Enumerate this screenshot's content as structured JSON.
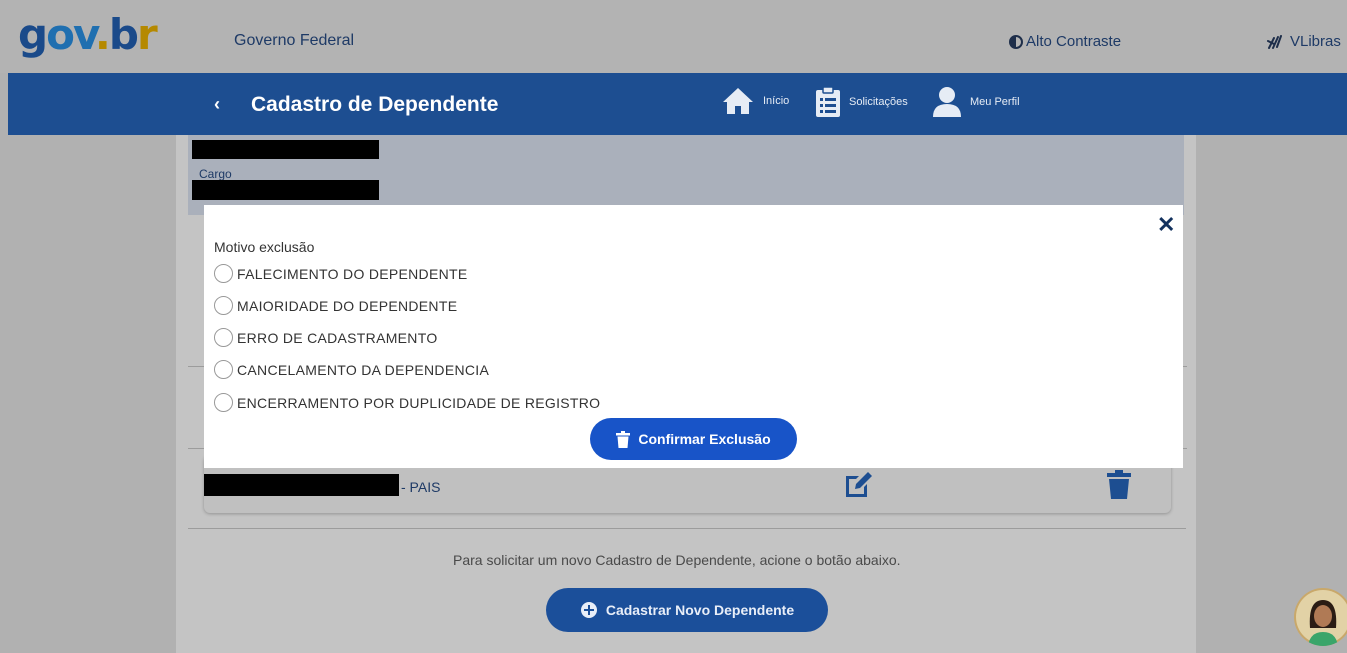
{
  "topbar": {
    "logo": {
      "g": "g",
      "o": "o",
      "v": "v",
      "dot": ".",
      "b": "b",
      "r": "r"
    },
    "gov_federal": "Governo Federal",
    "alto_contraste": "Alto Contraste",
    "vlibras": "VLibras"
  },
  "header": {
    "title": "Cadastro de Dependente",
    "nav": [
      {
        "label": "Início",
        "icon": "home-icon"
      },
      {
        "label": "Solicitações",
        "icon": "clipboard-icon"
      },
      {
        "label": "Meu Perfil",
        "icon": "user-icon"
      }
    ]
  },
  "info_card": {
    "cargo_label": "Cargo"
  },
  "dependent": {
    "relation": "- PAIS"
  },
  "footer": {
    "info": "Para solicitar um novo Cadastro de Dependente, acione o botão abaixo.",
    "new_button": "Cadastrar Novo Dependente"
  },
  "modal": {
    "label": "Motivo exclusão",
    "options": [
      "FALECIMENTO DO DEPENDENTE",
      "MAIORIDADE DO DEPENDENTE",
      "ERRO DE CADASTRAMENTO",
      "CANCELAMENTO DA DEPENDENCIA",
      "ENCERRAMENTO POR DUPLICIDADE DE REGISTRO"
    ],
    "confirm_button": "Confirmar Exclusão"
  },
  "colors": {
    "header_blue": "#1d4e91",
    "confirm_blue": "#1854c8",
    "overlay_gray": "#b1b1b1"
  }
}
